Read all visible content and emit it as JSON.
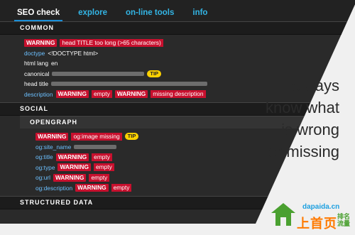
{
  "tabs": [
    {
      "label": "SEO check"
    },
    {
      "label": "explore"
    },
    {
      "label": "on-line tools"
    },
    {
      "label": "info"
    }
  ],
  "sections": {
    "common": "COMMON",
    "social": "SOCIAL",
    "opengraph": "OPENGRAPH",
    "structured": "STRUCTURED DATA"
  },
  "common": {
    "title_badge": "WARNING",
    "title_msg": "head TITLE too long (>65 characters)",
    "doctype_key": "doctype",
    "doctype_val": "<!DOCTYPE html>",
    "htmllang_key": "html lang",
    "htmllang_val": "en",
    "canonical_key": "canonical",
    "canonical_tip": "TIP",
    "headtitle_key": "head title",
    "desc_key": "description",
    "desc_badge1": "WARNING",
    "desc_msg1": "empty",
    "desc_badge2": "WARNING",
    "desc_msg2": "missing description"
  },
  "og": {
    "image_badge": "WARNING",
    "image_msg": "og:image missing",
    "image_tip": "TIP",
    "site_name_key": "og:site_name",
    "title_key": "og:title",
    "title_badge": "WARNING",
    "title_msg": "empty",
    "type_key": "og:type",
    "type_badge": "WARNING",
    "type_msg": "empty",
    "url_key": "og:url",
    "url_badge": "WARNING",
    "url_msg": "empty",
    "desc_key": "og:description",
    "desc_badge": "WARNING",
    "desc_msg": "empty"
  },
  "tagline": [
    "always",
    "know what",
    "is wrong",
    "or missing"
  ],
  "watermark": {
    "url": "dapaida.cn",
    "cn": "上首页",
    "cn2": "排名流量"
  },
  "colors": {
    "panel": "#2a2a2a",
    "tab_link": "#33b5e5",
    "warning": "#c8102e",
    "tip": "#ffd200",
    "key": "#6cc0ff"
  }
}
